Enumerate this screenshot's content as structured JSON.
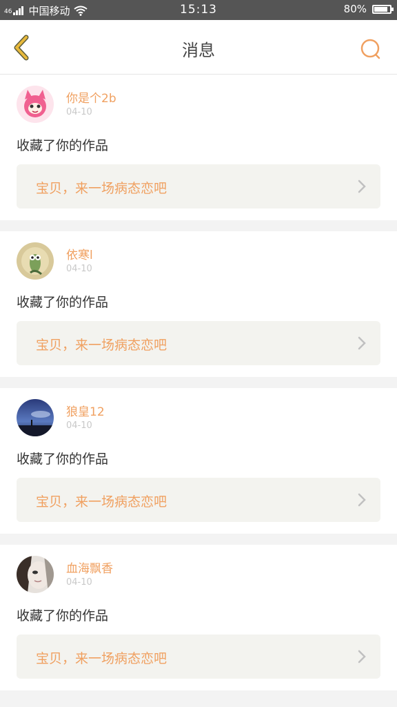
{
  "status_bar": {
    "signal": "46",
    "carrier": "中国移动",
    "time": "15:13",
    "battery": "80%"
  },
  "header": {
    "title": "消息"
  },
  "messages": [
    {
      "username": "你是个2b",
      "date": "04-10",
      "action": "收藏了你的作品",
      "work_title": "宝贝，来一场病态恋吧"
    },
    {
      "username": "依寒l",
      "date": "04-10",
      "action": "收藏了你的作品",
      "work_title": "宝贝，来一场病态恋吧"
    },
    {
      "username": "狼皇12",
      "date": "04-10",
      "action": "收藏了你的作品",
      "work_title": "宝贝，来一场病态恋吧"
    },
    {
      "username": "血海飘香",
      "date": "04-10",
      "action": "收藏了你的作品",
      "work_title": "宝贝，来一场病态恋吧"
    }
  ],
  "colors": {
    "accent": "#f0a060",
    "status_bar": "#555555",
    "back_icon": "#e8b93c"
  }
}
